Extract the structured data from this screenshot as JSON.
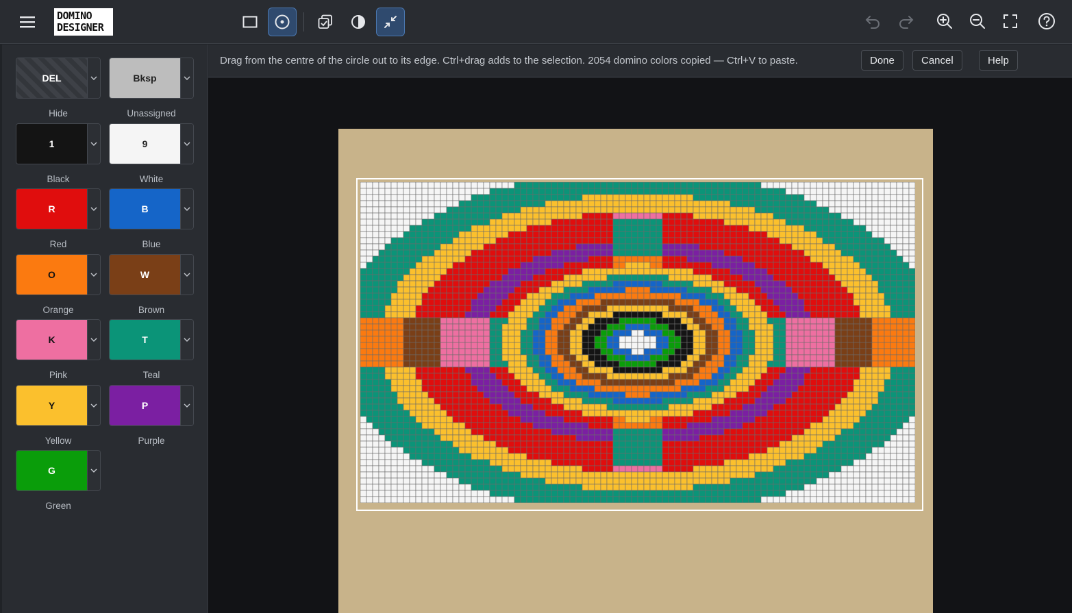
{
  "app": {
    "logo_line1": "DOMINO",
    "logo_line2": "DESIGNER"
  },
  "toolbar": {
    "menu_icon": "hamburger-icon",
    "tools": [
      {
        "name": "rectangle-select-tool",
        "icon": "square-icon",
        "active": false
      },
      {
        "name": "circle-select-tool",
        "icon": "circle-dot-icon",
        "active": true
      },
      {
        "name": "copy-tool",
        "icon": "copy-check-icon",
        "active": false
      },
      {
        "name": "contrast-tool",
        "icon": "contrast-icon",
        "active": false
      },
      {
        "name": "collapse-tool",
        "icon": "arrows-in-icon",
        "active": true
      }
    ],
    "right": [
      "undo-icon",
      "redo-icon",
      "zoom-in-icon",
      "zoom-out-icon",
      "fullscreen-icon",
      "help-circle-icon"
    ]
  },
  "hint": {
    "text": "Drag from the centre of the circle out to its edge. Ctrl+drag adds to the selection.  2054 domino colors copied — Ctrl+V to paste.",
    "done": "Done",
    "cancel": "Cancel",
    "help": "Help"
  },
  "palette": [
    {
      "key": "DEL",
      "name": "Hide",
      "color": "#3a3d42",
      "text": "#ffffff",
      "pattern": "hatch"
    },
    {
      "key": "Bksp",
      "name": "Unassigned",
      "color": "#bdbdbd",
      "text": "#222222"
    },
    {
      "key": "1",
      "name": "Black",
      "color": "#141414",
      "text": "#ffffff"
    },
    {
      "key": "9",
      "name": "White",
      "color": "#f5f5f5",
      "text": "#222222"
    },
    {
      "key": "R",
      "name": "Red",
      "color": "#e00d0d",
      "text": "#ffffff"
    },
    {
      "key": "B",
      "name": "Blue",
      "color": "#1565c8",
      "text": "#ffffff"
    },
    {
      "key": "O",
      "name": "Orange",
      "color": "#fb7a10",
      "text": "#111111"
    },
    {
      "key": "W",
      "name": "Brown",
      "color": "#7a3f17",
      "text": "#ffffff"
    },
    {
      "key": "K",
      "name": "Pink",
      "color": "#ee6fa1",
      "text": "#111111"
    },
    {
      "key": "T",
      "name": "Teal",
      "color": "#0b9478",
      "text": "#ffffff"
    },
    {
      "key": "Y",
      "name": "Yellow",
      "color": "#fbc02d",
      "text": "#111111"
    },
    {
      "key": "P",
      "name": "Purple",
      "color": "#7b1fa2",
      "text": "#ffffff"
    },
    {
      "key": "G",
      "name": "Green",
      "color": "#0a9d0a",
      "text": "#ffffff"
    }
  ],
  "grid": {
    "cols": 90,
    "rows": 52,
    "colors": {
      "R": "#e00d0d",
      "T": "#0b9478",
      "Y": "#fbc02d",
      "P": "#7b1fa2",
      "B": "#1565c8",
      "O": "#fb7a10",
      "W": "#7a3f17",
      "K": "#ee6fa1",
      "1": "#141414",
      "9": "#f5f5f5",
      "G": "#0a9d0a"
    },
    "line_color": "#6b6b6b",
    "board_color": "#c8b38a"
  }
}
